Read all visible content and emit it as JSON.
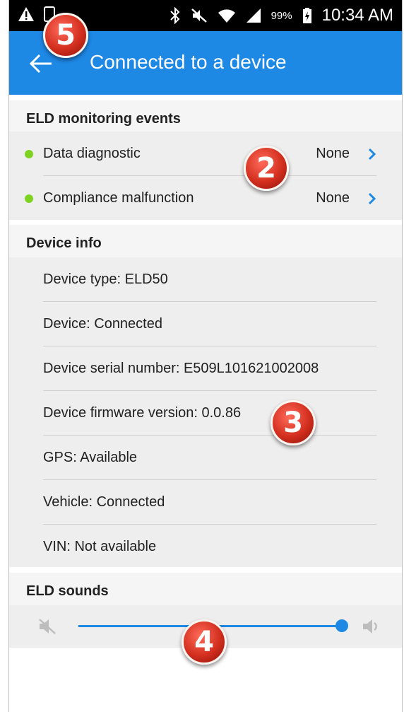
{
  "status_bar": {
    "battery_percent": "99%",
    "time": "10:34 AM",
    "icons": [
      "warning-icon",
      "sim-icon",
      "bluetooth-icon",
      "mute-icon",
      "wifi-icon",
      "signal-icon",
      "battery-charging-icon"
    ]
  },
  "app_bar": {
    "title": "Connected to a device",
    "back_icon": "arrow-left-icon"
  },
  "elds": {
    "header": "ELD monitoring events",
    "items": [
      {
        "label": "Data diagnostic",
        "value": "None",
        "status_color": "#7ed321"
      },
      {
        "label": "Compliance malfunction",
        "value": "None",
        "status_color": "#7ed321"
      }
    ]
  },
  "device_info": {
    "header": "Device info",
    "items": [
      {
        "label": "Device type: ELD50"
      },
      {
        "label": "Device: Connected"
      },
      {
        "label": "Device serial number: E509L101621002008"
      },
      {
        "label": "Device firmware version: 0.0.86"
      },
      {
        "label": "GPS: Available"
      },
      {
        "label": "Vehicle: Connected"
      },
      {
        "label": "VIN: Not available"
      }
    ]
  },
  "sounds": {
    "header": "ELD sounds",
    "volume_level": 1.0
  },
  "callouts": [
    "5",
    "2",
    "3",
    "4"
  ],
  "colors": {
    "accent": "#1e88e5",
    "status_ok": "#7ed321",
    "callout": "#d32f1f"
  }
}
